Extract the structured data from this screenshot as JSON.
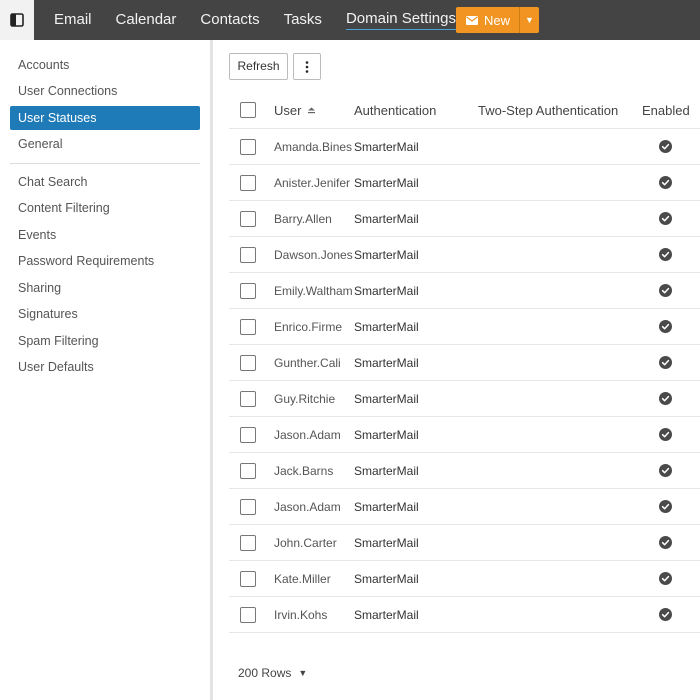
{
  "topnav": {
    "items": [
      {
        "label": "Email"
      },
      {
        "label": "Calendar"
      },
      {
        "label": "Contacts"
      },
      {
        "label": "Tasks"
      }
    ],
    "domain_settings": "Domain Settings",
    "new_button": "New"
  },
  "sidebar": {
    "items": [
      {
        "label": "Accounts"
      },
      {
        "label": "User Connections"
      },
      {
        "label": "User Statuses",
        "active": true
      },
      {
        "label": "General"
      },
      {
        "label": "Chat Search"
      },
      {
        "label": "Content Filtering"
      },
      {
        "label": "Events"
      },
      {
        "label": "Password Requirements"
      },
      {
        "label": "Sharing"
      },
      {
        "label": "Signatures"
      },
      {
        "label": "Spam Filtering"
      },
      {
        "label": "User Defaults"
      }
    ]
  },
  "toolbar": {
    "refresh": "Refresh"
  },
  "table": {
    "headers": {
      "user": "User",
      "authentication": "Authentication",
      "two_step": "Two-Step Authentication",
      "enabled": "Enabled"
    },
    "rows": [
      {
        "user": "Amanda.Bines",
        "auth": "SmarterMail",
        "enabled": true
      },
      {
        "user": "Anister.Jenifer",
        "auth": "SmarterMail",
        "enabled": true
      },
      {
        "user": "Barry.Allen",
        "auth": "SmarterMail",
        "enabled": true
      },
      {
        "user": "Dawson.Jones",
        "auth": "SmarterMail",
        "enabled": true
      },
      {
        "user": "Emily.Waltham",
        "auth": "SmarterMail",
        "enabled": true
      },
      {
        "user": "Enrico.Firme",
        "auth": "SmarterMail",
        "enabled": true
      },
      {
        "user": "Gunther.Cali",
        "auth": "SmarterMail",
        "enabled": true
      },
      {
        "user": "Guy.Ritchie",
        "auth": "SmarterMail",
        "enabled": true
      },
      {
        "user": "Jason.Adam",
        "auth": "SmarterMail",
        "enabled": true
      },
      {
        "user": "Jack.Barns",
        "auth": "SmarterMail",
        "enabled": true
      },
      {
        "user": "Jason.Adam",
        "auth": "SmarterMail",
        "enabled": true
      },
      {
        "user": "John.Carter",
        "auth": "SmarterMail",
        "enabled": true
      },
      {
        "user": "Kate.Miller",
        "auth": "SmarterMail",
        "enabled": true
      },
      {
        "user": "Irvin.Kohs",
        "auth": "SmarterMail",
        "enabled": true
      }
    ]
  },
  "footer": {
    "rows_label": "200 Rows"
  },
  "icons": {
    "sidebar_toggle": "sidebar-toggle-icon",
    "new_mail": "envelope-icon",
    "more": "vertical-dots-icon",
    "sort": "sort-ascending-icon",
    "enabled": "check-circle-icon"
  },
  "colors": {
    "topbar": "#444444",
    "accent_orange": "#f29422",
    "active_blue": "#1f7ab8",
    "domain_underline": "#4aa3df",
    "check_icon": "#4a4a4a"
  }
}
